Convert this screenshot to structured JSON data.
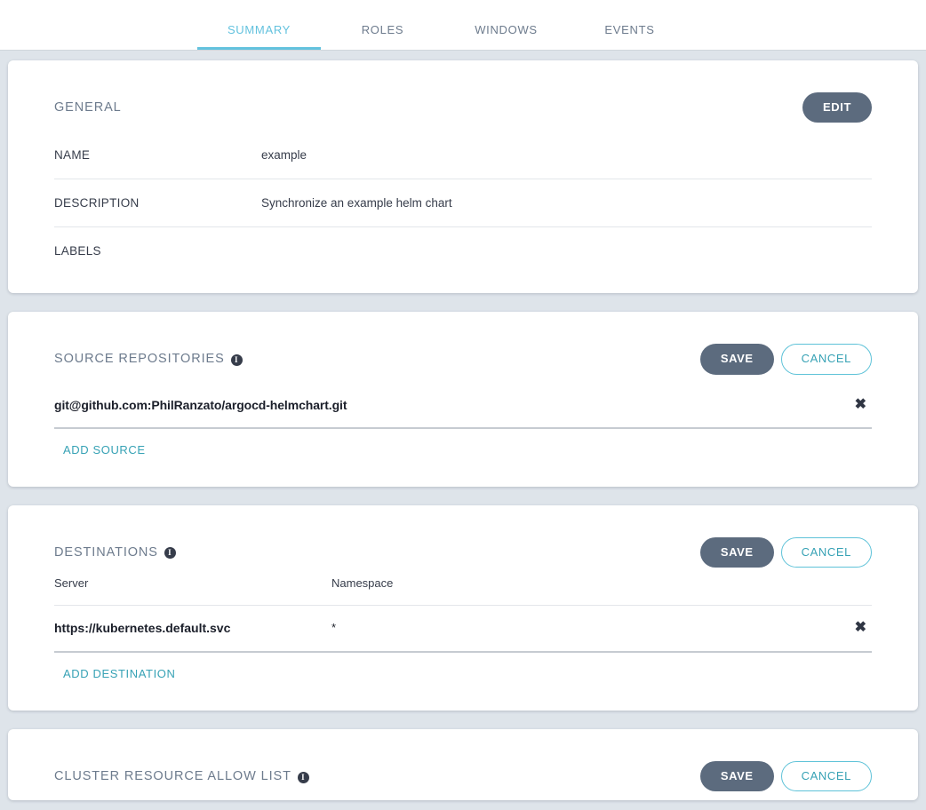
{
  "tabs": [
    {
      "label": "SUMMARY",
      "active": true
    },
    {
      "label": "ROLES",
      "active": false
    },
    {
      "label": "WINDOWS",
      "active": false
    },
    {
      "label": "EVENTS",
      "active": false
    }
  ],
  "colors": {
    "background": "#dee4ea",
    "card": "#ffffff",
    "accent_cyan": "#63c2de",
    "link_teal": "#37a2b5",
    "button_slate": "#5c6b7e",
    "heading_slate": "#6d7b8d",
    "text_dark": "#363c4a",
    "divider_light": "#e3e6ea",
    "divider_strong": "#c6cbd1"
  },
  "general": {
    "title": "GENERAL",
    "edit_label": "EDIT",
    "fields": [
      {
        "label": "NAME",
        "value": "example"
      },
      {
        "label": "DESCRIPTION",
        "value": "Synchronize an example helm chart"
      },
      {
        "label": "LABELS",
        "value": ""
      }
    ]
  },
  "source_repositories": {
    "title": "SOURCE REPOSITORIES",
    "info_glyph": "i",
    "save_label": "SAVE",
    "cancel_label": "CANCEL",
    "items": [
      {
        "url": "git@github.com:PhilRanzato/argocd-helmchart.git",
        "remove_glyph": "✖"
      }
    ],
    "add_label": "ADD SOURCE"
  },
  "destinations": {
    "title": "DESTINATIONS",
    "info_glyph": "i",
    "save_label": "SAVE",
    "cancel_label": "CANCEL",
    "columns": [
      "Server",
      "Namespace"
    ],
    "rows": [
      {
        "server": "https://kubernetes.default.svc",
        "namespace": "*",
        "remove_glyph": "✖"
      }
    ],
    "add_label": "ADD DESTINATION"
  },
  "cluster_resource_allow_list": {
    "title": "CLUSTER RESOURCE ALLOW LIST",
    "info_glyph": "i",
    "save_label": "SAVE",
    "cancel_label": "CANCEL"
  }
}
